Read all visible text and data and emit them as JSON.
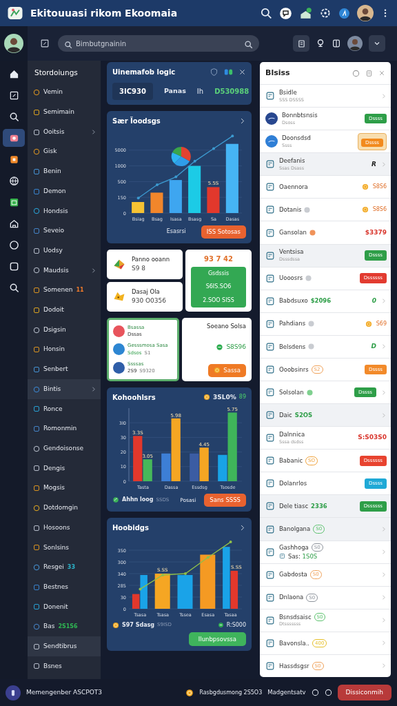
{
  "header": {
    "title": "Ekitouuasi rikom Ekoomaia"
  },
  "toolbar": {
    "search_placeholder": "Bimbutgnainin"
  },
  "rail": [
    {
      "selected": false
    },
    {
      "selected": false
    },
    {
      "selected": false
    },
    {
      "selected": true
    },
    {
      "selected": false
    },
    {
      "selected": false
    },
    {
      "selected": false
    },
    {
      "selected": false
    },
    {
      "selected": false
    },
    {
      "selected": false
    },
    {
      "selected": false
    }
  ],
  "sidebar": {
    "title": "Stordoiungs",
    "items": [
      {
        "label": "Vemin",
        "selected": false,
        "chevron": false
      },
      {
        "label": "Semimain",
        "selected": false,
        "chevron": false
      },
      {
        "label": "Ooitsis",
        "selected": false,
        "chevron": true
      },
      {
        "label": "Gisk",
        "selected": false,
        "chevron": false
      },
      {
        "label": "Benin",
        "selected": false,
        "chevron": false
      },
      {
        "label": "Demon",
        "selected": false,
        "chevron": false
      },
      {
        "label": "Hondsis",
        "selected": false,
        "chevron": false
      },
      {
        "label": "Seveio",
        "selected": false,
        "chevron": false
      },
      {
        "label": "Uodsy",
        "selected": false,
        "chevron": false
      },
      {
        "label": "Maudsis",
        "selected": false,
        "chevron": true
      },
      {
        "label": "Somenen",
        "selected": false,
        "chevron": false,
        "badge": {
          "text": "11",
          "color": "#f07a2a"
        }
      },
      {
        "label": "Dodoit",
        "selected": false,
        "chevron": false
      },
      {
        "label": "Dsigsin",
        "selected": false,
        "chevron": false
      },
      {
        "label": "Honsin",
        "selected": false,
        "chevron": false
      },
      {
        "label": "Senbert",
        "selected": false,
        "chevron": false
      },
      {
        "label": "Bintis",
        "selected": true,
        "chevron": true
      },
      {
        "label": "Ronce",
        "selected": false,
        "chevron": false
      },
      {
        "label": "Romonmin",
        "selected": false,
        "chevron": false
      },
      {
        "label": "Gendoisonse",
        "selected": false,
        "chevron": false
      },
      {
        "label": "Dengis",
        "selected": false,
        "chevron": false
      },
      {
        "label": "Mogsis",
        "selected": false,
        "chevron": false
      },
      {
        "label": "Dotdomgin",
        "selected": false,
        "chevron": false
      },
      {
        "label": "Hosoons",
        "selected": false,
        "chevron": false
      },
      {
        "label": "Sonlsins",
        "selected": false,
        "chevron": false
      },
      {
        "label": "Resgei",
        "selected": false,
        "chevron": false,
        "badge": {
          "text": "33",
          "color": "#2bb3c9"
        }
      },
      {
        "label": "Bestnes",
        "selected": false,
        "chevron": false
      },
      {
        "label": "Donenit",
        "selected": false,
        "chevron": false
      },
      {
        "label": "Bas",
        "selected": false,
        "chevron": false,
        "badge": {
          "text": "2S1S6",
          "color": "#2fb552"
        }
      },
      {
        "label": "Sendtibrus",
        "selected": true,
        "chevron": false
      },
      {
        "label": "Bsnes",
        "selected": false,
        "chevron": false
      }
    ]
  },
  "summary": {
    "title": "Uinemafob logic",
    "code": "3IC930",
    "label": "Panas",
    "separator": "Ih",
    "value": "D530988"
  },
  "chart1": {
    "title": "Sær Ïoodsgs",
    "footer_text": "Esasrsi",
    "button": "ISS Sotosas",
    "y_labels": [
      "5000",
      "1000",
      "500",
      "150",
      "0"
    ],
    "x_labels": [
      "Bsiag",
      "Bsag",
      "Isasa",
      "Bsasg",
      "Sa",
      "Dasas"
    ],
    "bar_labels": [
      "5.5S"
    ]
  },
  "tiles": [
    {
      "title": "Panno ooann",
      "value": "S9 8"
    },
    {
      "title": "Dasaj Ola",
      "value": "930 O0356"
    }
  ],
  "stat": {
    "value": "93 7 42",
    "lines": [
      "Gsdssis",
      "S6IS.SO6",
      "2.SOO SISS"
    ]
  },
  "people": [
    {
      "title": "Bsassa",
      "subtitle": "Dssas",
      "color": "#e8545c"
    },
    {
      "title": "Gesssmosa Sasa",
      "subtitle": "Sdsos",
      "note": "S1",
      "color": "#2d86d2"
    },
    {
      "title": "Ssssas",
      "subtitle": "2S9",
      "note": "S9320",
      "color": "#2f5ea8"
    }
  ],
  "offer": {
    "title": "Soeano Solsa",
    "value": "S8S96",
    "button": "Sassa"
  },
  "chart2": {
    "title": "Kohoohlsrs",
    "stat": "3SL0%",
    "stat_note": "89",
    "footer_left": "Ahhn loog",
    "footer_note": "SSDS",
    "footer_mid": "Posasi",
    "button": "Sans SSSS",
    "chart_data": {
      "type": "bar",
      "grid": true,
      "categories": [
        "Tasta",
        "Dassa",
        "Essdsg",
        "Tsosde"
      ],
      "ylim": [
        0,
        50
      ],
      "yticks": [
        0,
        10,
        20,
        30,
        {
          "value": 40,
          "label": "3I0"
        }
      ],
      "series": [
        {
          "colors": [
            "#e2382c",
            "#3d7fd6",
            "#3b5ca3",
            "#19a3e6"
          ],
          "values": [
            31,
            19,
            19,
            18
          ]
        },
        {
          "colors": [
            "#46b85a",
            "#f5a623",
            "#f5a623",
            "#3fb55a"
          ],
          "values": [
            15,
            43,
            23,
            47
          ]
        }
      ],
      "value_labels": [
        [
          "3.3S",
          null,
          null,
          null
        ],
        [
          "3.05",
          "5.98",
          "4.45",
          "5.75"
        ]
      ]
    }
  },
  "chart3": {
    "title": "Hoobidgs",
    "footer_left": "S97 Sdasg",
    "footer_note": "S9ISD",
    "footer_right": "R:S000",
    "button": "Ilunbpsovssa",
    "y_labels": [
      "350",
      "300",
      "340",
      "285",
      "30",
      "0"
    ],
    "x_labels": [
      "Tsasa",
      "Tsasa",
      "Tssea",
      "Esasa",
      "Tasaa"
    ],
    "bar_labels": [
      "S.SS",
      "S.SS"
    ]
  },
  "panel": {
    "title": "Blsiss",
    "rows": [
      {
        "kind": "icon",
        "title": "Bsidle",
        "subtitle": "SSS DSSSS",
        "chevron": true,
        "highlighted": false
      },
      {
        "kind": "avatar",
        "title": "Bonnbtsnsis",
        "subtitle": "Dsoss",
        "chevron": false,
        "highlighted": false,
        "badge": {
          "text": "Dssss",
          "color": "#2e9e48",
          "highlighted": false
        }
      },
      {
        "kind": "avatar",
        "title": "Doonsdsd",
        "subtitle": "Ssss",
        "chevron": false,
        "highlighted": false,
        "badge": {
          "text": "Dssss",
          "color": "#f28a1e",
          "highlighted": true
        }
      },
      {
        "kind": "icon",
        "title": "Deefanis",
        "subtitle": "Ssas Dsass",
        "chevron": true,
        "highlighted": true,
        "mark": {
          "text": "R",
          "color": "#222222"
        }
      },
      {
        "kind": "icon",
        "title": "Oaennora",
        "chevron": false,
        "highlighted": false,
        "coin": "S8S6"
      },
      {
        "kind": "icon",
        "title": "Dotanis",
        "chevron": false,
        "highlighted": false,
        "tag": {
          "kind": "dot",
          "color": "#c9ccd1"
        },
        "coin": "S8S6"
      },
      {
        "kind": "icon",
        "title": "Gansolan",
        "chevron": false,
        "highlighted": false,
        "tag": {
          "kind": "dot",
          "color": "#f0935a"
        },
        "amount": {
          "text": "$3379",
          "color": "#d9382f"
        }
      },
      {
        "kind": "icon",
        "title": "Ventsisa",
        "subtitle": "Dsssdssa",
        "chevron": false,
        "highlighted": true,
        "badge": {
          "text": "Dssss",
          "color": "#2e9e48",
          "highlighted": false
        }
      },
      {
        "kind": "icon",
        "title": "Uooosrs",
        "chevron": false,
        "highlighted": false,
        "tag": {
          "kind": "dot",
          "color": "#c9ccd1"
        },
        "badge": {
          "text": "Dssssss",
          "color": "#e23b30",
          "highlighted": false
        }
      },
      {
        "kind": "icon",
        "title": "Babdsuxo",
        "chevron": true,
        "highlighted": false,
        "tag": {
          "kind": "text",
          "text": "$2096",
          "color": "#2e9e48"
        },
        "mark": {
          "text": "0",
          "color": "#2e9e48"
        }
      },
      {
        "kind": "icon",
        "title": "Pahdians",
        "chevron": false,
        "highlighted": false,
        "tag": {
          "kind": "dot",
          "color": "#c9ccd1"
        },
        "coin": "S69"
      },
      {
        "kind": "icon",
        "title": "Belsdens",
        "chevron": true,
        "highlighted": false,
        "tag": {
          "kind": "dot",
          "color": "#c9ccd1"
        },
        "mark": {
          "text": "D",
          "color": "#2e9e48"
        }
      },
      {
        "kind": "icon",
        "title": "Ooobsinrs",
        "chevron": false,
        "highlighted": false,
        "tag": {
          "kind": "pill",
          "text": "S2",
          "color": "#f0a25a"
        },
        "badge": {
          "text": "Dssss",
          "color": "#f28a2a",
          "highlighted": false
        }
      },
      {
        "kind": "icon",
        "title": "Solsolan",
        "chevron": true,
        "highlighted": false,
        "tag": {
          "kind": "dot",
          "color": "#7fd08f"
        },
        "badge": {
          "text": "Dssss",
          "color": "#2e9e48",
          "highlighted": false
        }
      },
      {
        "kind": "icon",
        "title": "Daic",
        "chevron": true,
        "highlighted": true,
        "tag": {
          "kind": "text",
          "text": "S2OS",
          "color": "#2e9e48"
        }
      },
      {
        "kind": "icon",
        "title": "Dalnnica",
        "subtitle": "Sssa dsdss",
        "chevron": false,
        "highlighted": false,
        "amount": {
          "text": "S:S03S0",
          "color": "#d9382f"
        }
      },
      {
        "kind": "icon",
        "title": "Babanic",
        "chevron": false,
        "highlighted": false,
        "tag": {
          "kind": "pill",
          "text": "SO",
          "color": "#f0a23a"
        },
        "badge": {
          "text": "Dssssss",
          "color": "#e8432f",
          "highlighted": false
        }
      },
      {
        "kind": "icon",
        "title": "Dolanrlos",
        "chevron": false,
        "highlighted": false,
        "badge": {
          "text": "Dssss",
          "color": "#1fa9d6",
          "highlighted": false
        }
      },
      {
        "kind": "icon",
        "title": "Dele tiasc",
        "chevron": false,
        "highlighted": true,
        "tag": {
          "kind": "text",
          "text": "2336",
          "color": "#2e9e48"
        },
        "badge": {
          "text": "Dssssss",
          "color": "#2e9e48",
          "highlighted": false
        }
      },
      {
        "kind": "icon",
        "title": "Banolgana",
        "chevron": true,
        "highlighted": true,
        "tag": {
          "kind": "pill",
          "text": "S0",
          "color": "#5cc26e"
        }
      },
      {
        "kind": "icon",
        "title": "Gashhoga",
        "chevron": true,
        "highlighted": false,
        "tag": {
          "kind": "pill",
          "text": "S0",
          "color": "#8e949c"
        },
        "detail": {
          "label": "Sas:",
          "value": "1S0S"
        }
      },
      {
        "kind": "icon",
        "title": "Gabdosta",
        "chevron": true,
        "highlighted": false,
        "tag": {
          "kind": "pill",
          "text": "S0",
          "color": "#f0a25a"
        }
      },
      {
        "kind": "icon",
        "title": "Dnlaona",
        "chevron": true,
        "highlighted": false,
        "tag": {
          "kind": "pill",
          "text": "S0",
          "color": "#8e949c"
        }
      },
      {
        "kind": "icon",
        "title": "Bsnsdsaisc",
        "subtitle": "Dtsssssss",
        "chevron": true,
        "highlighted": false,
        "tag": {
          "kind": "pill",
          "text": "S0",
          "color": "#5cc26e"
        }
      },
      {
        "kind": "icon",
        "title": "Bavonsla..",
        "chevron": true,
        "highlighted": false,
        "tag": {
          "kind": "pill",
          "text": "400",
          "color": "#e6c02a"
        }
      },
      {
        "kind": "icon",
        "title": "Hassdsgsr",
        "chevron": true,
        "highlighted": false,
        "tag": {
          "kind": "pill",
          "text": "S0",
          "color": "#f0a25a"
        }
      }
    ]
  },
  "footer": {
    "user": "Memengenber ASCPOT3",
    "status": "Rasbgdusmong 2S5O3",
    "label": "Madgentsatv",
    "button": "Dissiconmih"
  }
}
